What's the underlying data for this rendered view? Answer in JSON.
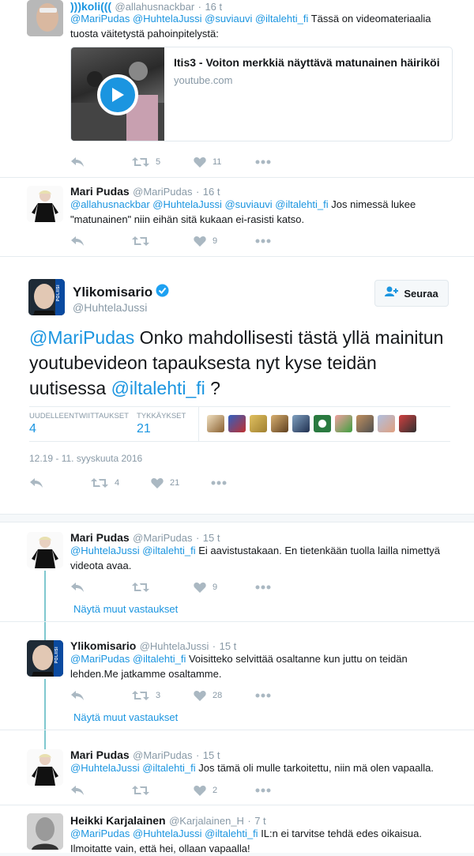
{
  "tweet1": {
    "name": ")))koli(((",
    "handle": "@allahusnackbar",
    "time": "16 t",
    "mentions": "@MariPudas @HuhtelaJussi @suviauvi @iltalehti_fi",
    "text": " Tässä on videomateriaalia tuosta väitetystä pahoinpitelystä:",
    "card_title": "Itis3 - Voiton merkkiä näyttävä matunainen häiriköi",
    "card_domain": "youtube.com",
    "retweets": "5",
    "likes": "11"
  },
  "tweet2": {
    "name": "Mari Pudas",
    "handle": "@MariPudas",
    "time": "16 t",
    "mentions": "@allahusnackbar @HuhtelaJussi @suviauvi @iltalehti_fi",
    "text": " Jos nimessä lukee \"matunainen\" niin eihän sitä kukaan ei-rasisti katso.",
    "likes": "9"
  },
  "main": {
    "name": "Ylikomisario",
    "handle": "@HuhtelaJussi",
    "follow_label": "Seuraa",
    "mention1": "@MariPudas",
    "text1": " Onko mahdollisesti tästä yllä mainitun youtubevideon tapauksesta nyt kyse teidän uutisessa ",
    "mention2": "@iltalehti_fi",
    "text2": " ?",
    "stat_retweets_label": "UUDELLEENTWIITTAUKSET",
    "stat_retweets": "4",
    "stat_likes_label": "TYKKÄYKSET",
    "stat_likes": "21",
    "timestamp": "12.19 - 11. syyskuuta 2016",
    "retweets": "4",
    "likes": "21"
  },
  "reply1": {
    "name": "Mari Pudas",
    "handle": "@MariPudas",
    "time": "15 t",
    "mentions": "@HuhtelaJussi @iltalehti_fi",
    "text": " Ei aavistustakaan. En tietenkään tuolla lailla nimettyä videota avaa.",
    "likes": "9",
    "more": "Näytä muut vastaukset"
  },
  "reply2": {
    "name": "Ylikomisario",
    "handle": "@HuhtelaJussi",
    "time": "15 t",
    "mentions": "@MariPudas @iltalehti_fi",
    "text": " Voisitteko selvittää osaltanne kun juttu on teidän lehden.Me jatkamme osaltamme.",
    "retweets": "3",
    "likes": "28",
    "more": "Näytä muut vastaukset"
  },
  "reply3": {
    "name": "Mari Pudas",
    "handle": "@MariPudas",
    "time": "15 t",
    "mentions": "@HuhtelaJussi @iltalehti_fi",
    "text": " Jos tämä oli mulle tarkoitettu, niin mä olen vapaalla.",
    "likes": "2"
  },
  "reply4": {
    "name": "Heikki Karjalainen",
    "handle": "@Karjalainen_H",
    "time": "7 t",
    "mentions": "@MariPudas @HuhtelaJussi @iltalehti_fi",
    "text": " IL:n ei tarvitse tehdä edes oikaisua. Ilmoitatte vain, että hei, ollaan vapaalla!"
  },
  "police_badge": "POLIISI",
  "colors": {
    "link": "#1b95e0",
    "muted": "#8899a6",
    "thread": "#7fc8cf",
    "verified": "#1da1f2"
  }
}
